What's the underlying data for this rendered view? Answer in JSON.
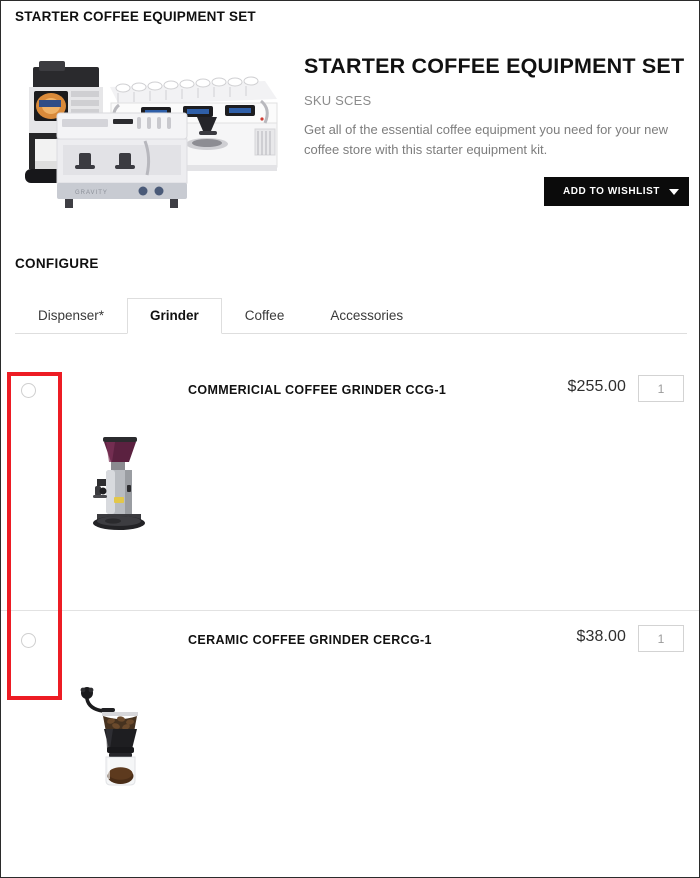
{
  "breadcrumb": "STARTER COFFEE EQUIPMENT SET",
  "hero": {
    "title": "STARTER COFFEE EQUIPMENT SET",
    "sku": "SKU SCES",
    "description": "Get all of the essential coffee equipment you need for your new coffee store with this starter equipment kit.",
    "wishlist_label": "ADD TO WISHLIST",
    "image_alt": "coffee-equipment-set-photo"
  },
  "configure": {
    "heading": "CONFIGURE",
    "tabs": [
      {
        "label": "Dispenser*",
        "active": false
      },
      {
        "label": "Grinder",
        "active": true
      },
      {
        "label": "Coffee",
        "active": false
      },
      {
        "label": "Accessories",
        "active": false
      }
    ],
    "options": [
      {
        "name": "COMMERICIAL COFFEE GRINDER CCG-1",
        "price": "$255.00",
        "qty": "1",
        "selected": false,
        "image_alt": "commercial-coffee-grinder-photo"
      },
      {
        "name": "CERAMIC COFFEE GRINDER CERCG-1",
        "price": "$38.00",
        "qty": "1",
        "selected": false,
        "image_alt": "ceramic-hand-coffee-grinder-photo"
      }
    ]
  },
  "annotation": {
    "color": "#ed1c24",
    "target": "radio-button-column"
  }
}
